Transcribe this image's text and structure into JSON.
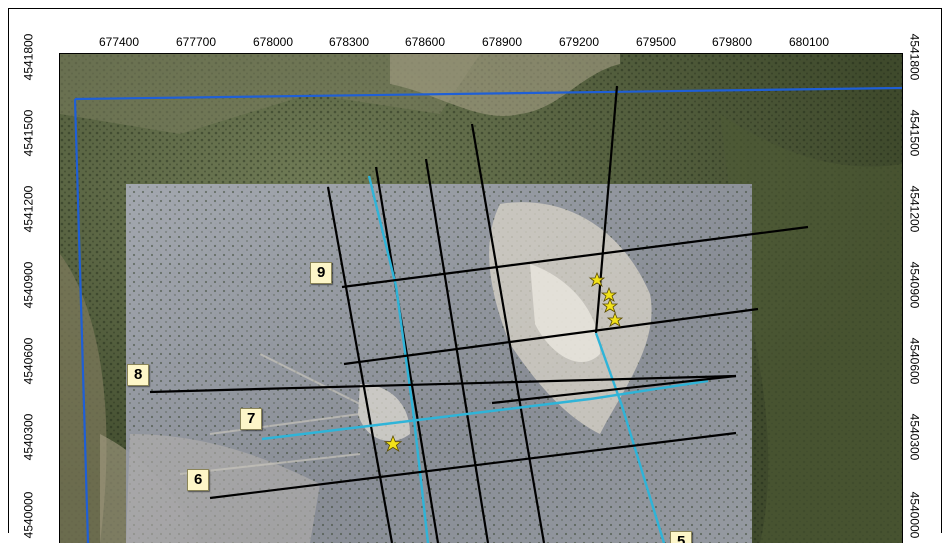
{
  "map": {
    "easting_ticks": [
      "677400",
      "677700",
      "678000",
      "678300",
      "678600",
      "678900",
      "679200",
      "679500",
      "679800",
      "680100"
    ],
    "northing_ticks_left": [
      "4541800",
      "4541500",
      "4541200",
      "4540900",
      "4540600",
      "4540300",
      "4540000"
    ],
    "northing_ticks_right": [
      "4541800",
      "4541500",
      "4541200",
      "4540900",
      "4540600",
      "4540300",
      "4540000"
    ],
    "line_labels": [
      "9",
      "8",
      "7",
      "6",
      "5"
    ],
    "colors": {
      "survey_line": "#000000",
      "highlight_line": "#2fb4d8",
      "boundary": "#1f5fd6",
      "label_fill": "#fdf6c8",
      "star": "#f2e21a"
    },
    "symbols": [
      "star-icon",
      "star-icon",
      "star-icon",
      "star-icon",
      "star-icon"
    ]
  }
}
